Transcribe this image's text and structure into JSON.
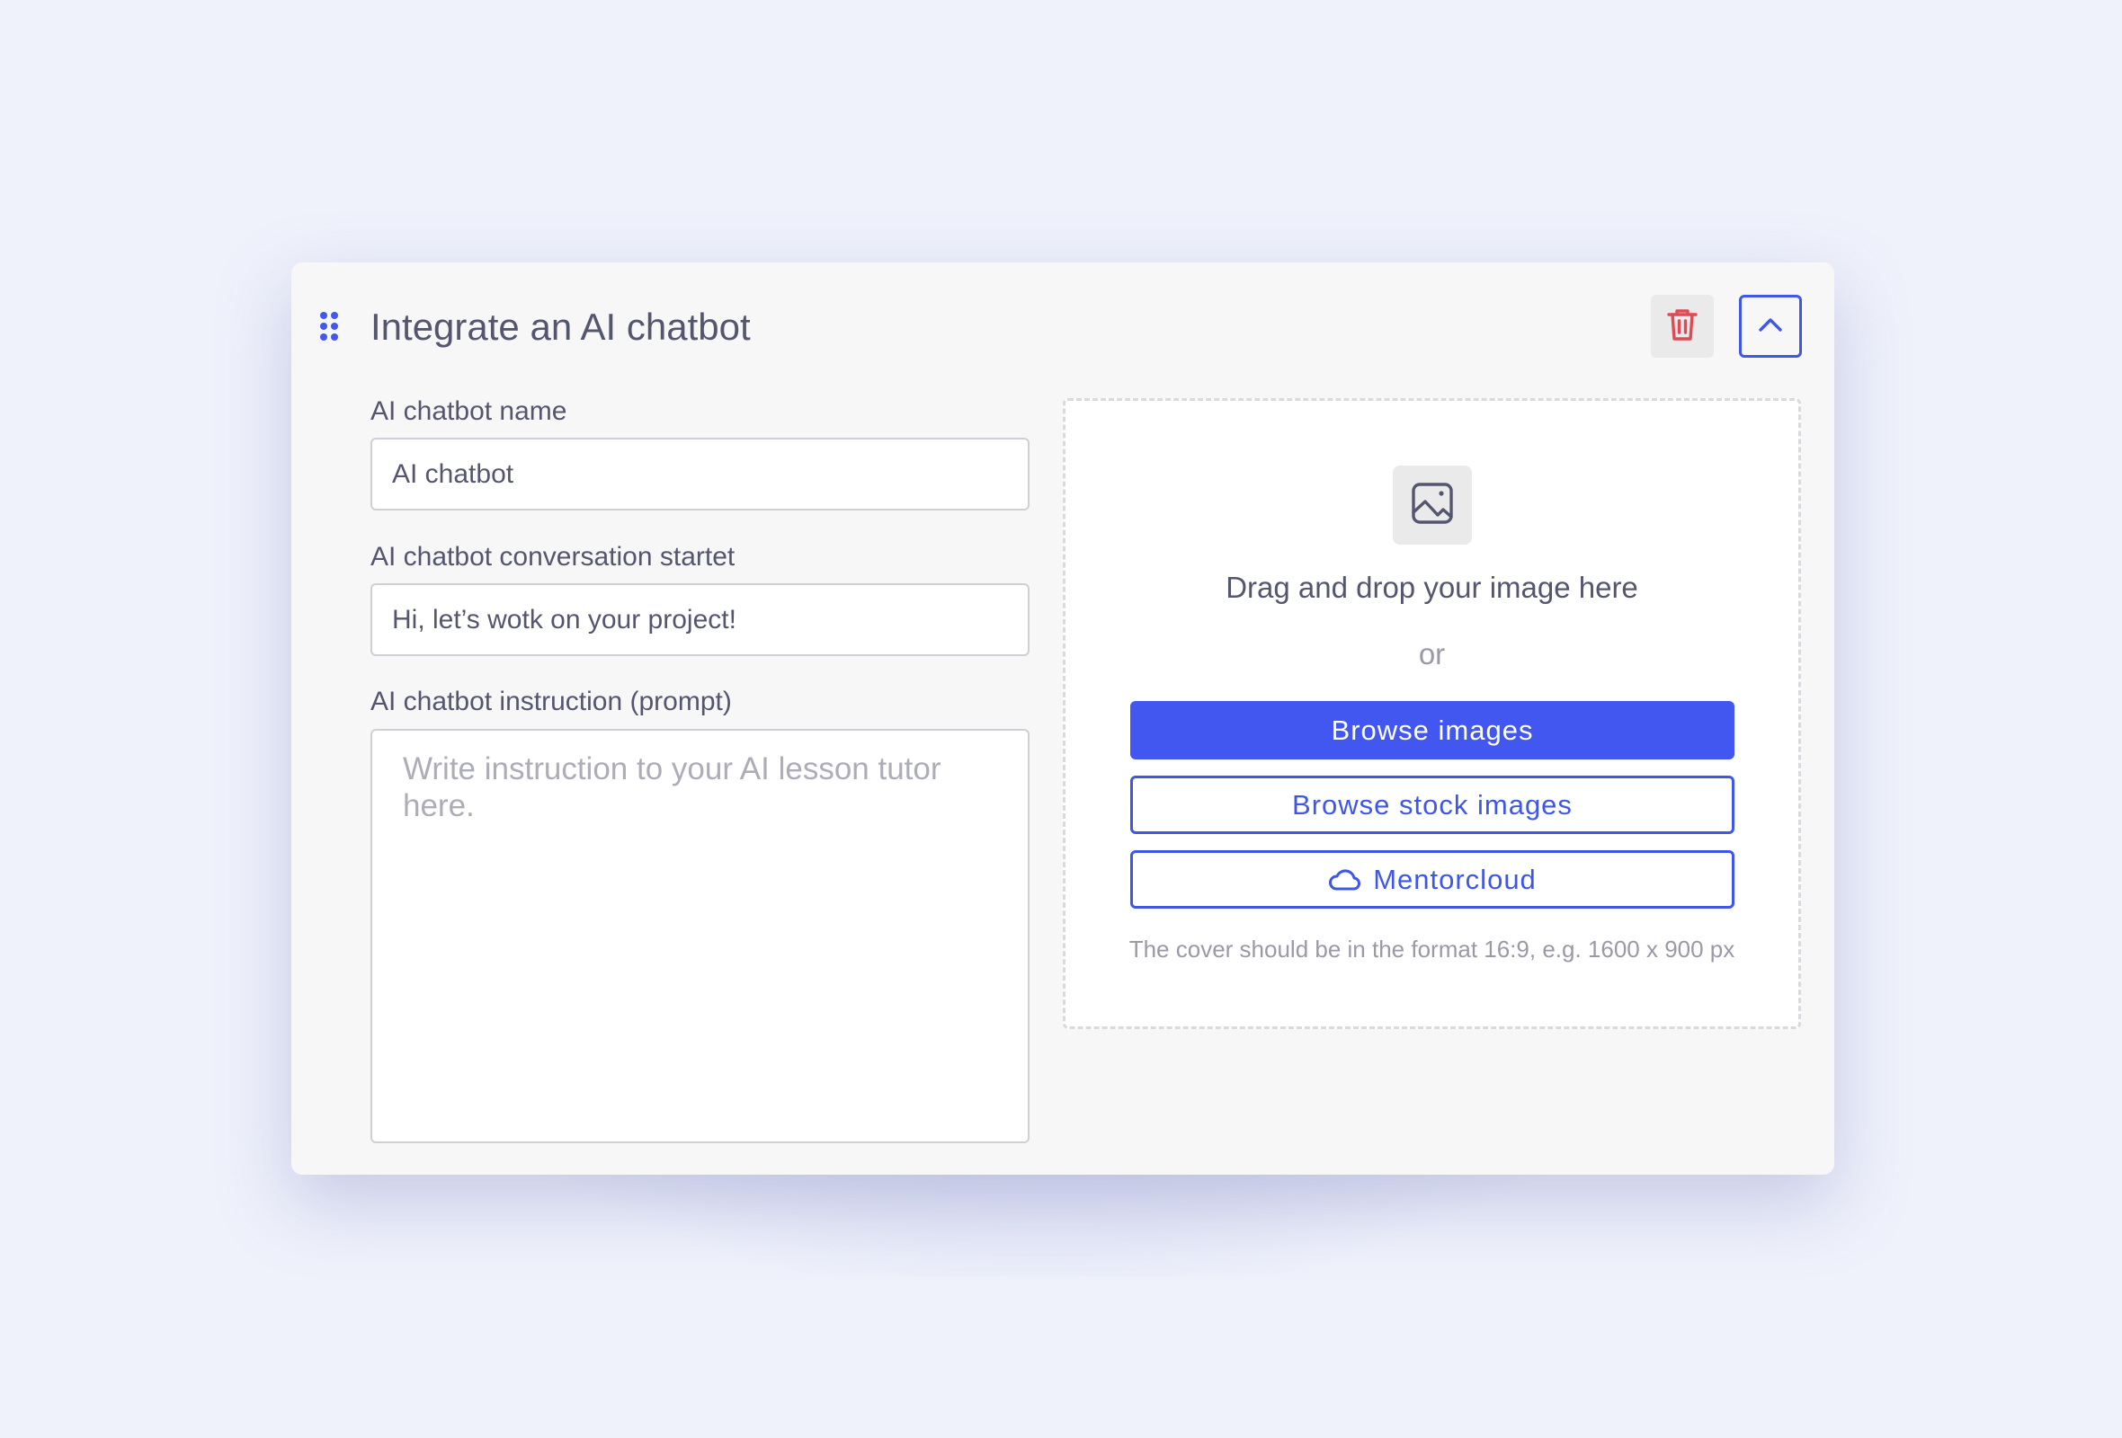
{
  "card": {
    "title": "Integrate an AI chatbot"
  },
  "icons": {
    "drag": "drag-handle-icon",
    "delete": "trash-icon",
    "collapse": "chevron-up-icon",
    "image": "image-icon",
    "cloud": "cloud-icon"
  },
  "colors": {
    "accent": "#4257f0",
    "danger": "#e04a55",
    "text": "#545670",
    "muted": "#9a9aa6"
  },
  "form": {
    "name_label": "AI chatbot name",
    "name_value": "AI chatbot",
    "starter_label": "AI chatbot conversation startet",
    "starter_value": "Hi, let’s wotk on your project!",
    "instruction_label": "AI chatbot instruction (prompt)",
    "instruction_placeholder": "Write instruction to your AI lesson tutor here."
  },
  "upload": {
    "title": "Drag and drop your image here",
    "or": "or",
    "browse_label": "Browse images",
    "stock_label": "Browse stock images",
    "cloud_label": "Mentorcloud",
    "hint": "The cover should be in the format 16:9, e.g. 1600 x 900 px"
  }
}
